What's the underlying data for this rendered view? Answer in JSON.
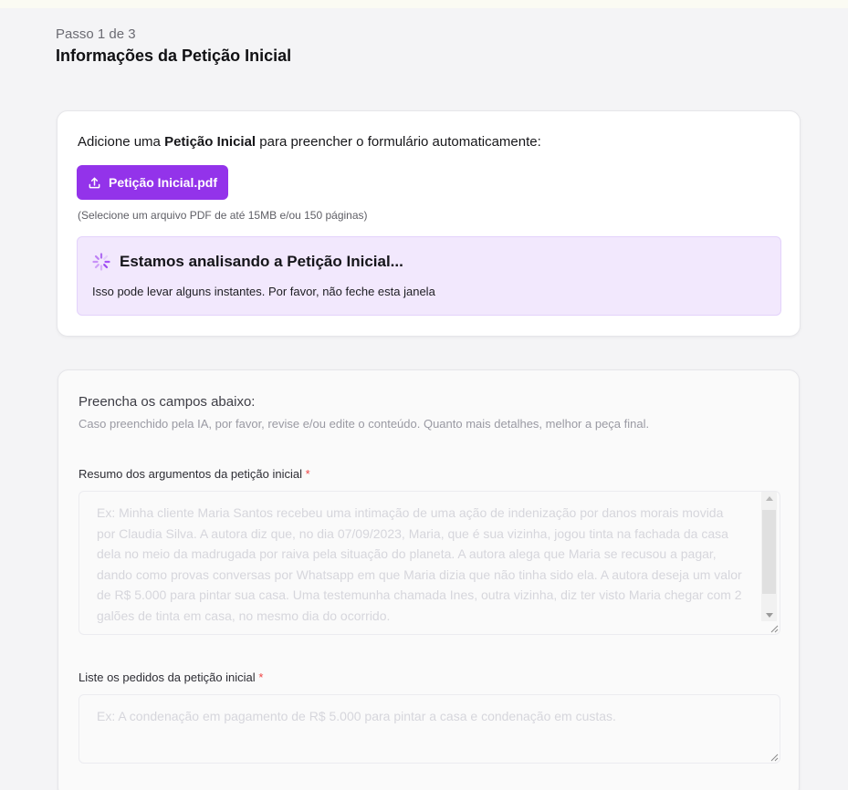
{
  "header": {
    "step": "Passo 1 de 3",
    "title": "Informações da Petição Inicial"
  },
  "upload": {
    "intro_before": "Adicione uma ",
    "intro_bold": "Petição Inicial",
    "intro_after": " para preencher o formulário automaticamente:",
    "button_label": "Petição Inicial.pdf",
    "button_icon": "upload-icon",
    "hint": "(Selecione um arquivo PDF de até 15MB e/ou 150 páginas)",
    "status": {
      "icon": "spinner-icon",
      "title": "Estamos analisando a Petição Inicial...",
      "text": "Isso pode levar alguns instantes. Por favor, não feche esta janela"
    }
  },
  "form": {
    "heading": "Preencha os campos abaixo:",
    "subheading": "Caso preenchido pela IA, por favor, revise e/ou edite o conteúdo. Quanto mais detalhes, melhor a peça final.",
    "fields": [
      {
        "label": "Resumo dos argumentos da petição inicial",
        "required_mark": "*",
        "value": "",
        "placeholder": "Ex: Minha cliente Maria Santos recebeu uma intimação de uma ação de indenização por danos morais movida por Claudia Silva. A autora diz que, no dia 07/09/2023, Maria, que é sua vizinha, jogou tinta na fachada da casa dela no meio da madrugada por raiva pela situação do planeta. A autora alega que Maria se recusou a pagar, dando como provas conversas por Whatsapp em que Maria dizia que não tinha sido ela. A autora deseja um valor de R$ 5.000 para pintar sua casa. Uma testemunha chamada Ines, outra vizinha, diz ter visto Maria chegar com 2 galões de tinta em casa, no mesmo dia do ocorrido."
      },
      {
        "label": "Liste os pedidos da petição inicial",
        "required_mark": "*",
        "value": "",
        "placeholder": "Ex: A condenação em pagamento de R$ 5.000 para pintar a casa e condenação em custas."
      }
    ]
  },
  "colors": {
    "accent": "#9333ea",
    "status_bg": "#f2e8fd",
    "required": "#ef4444"
  }
}
